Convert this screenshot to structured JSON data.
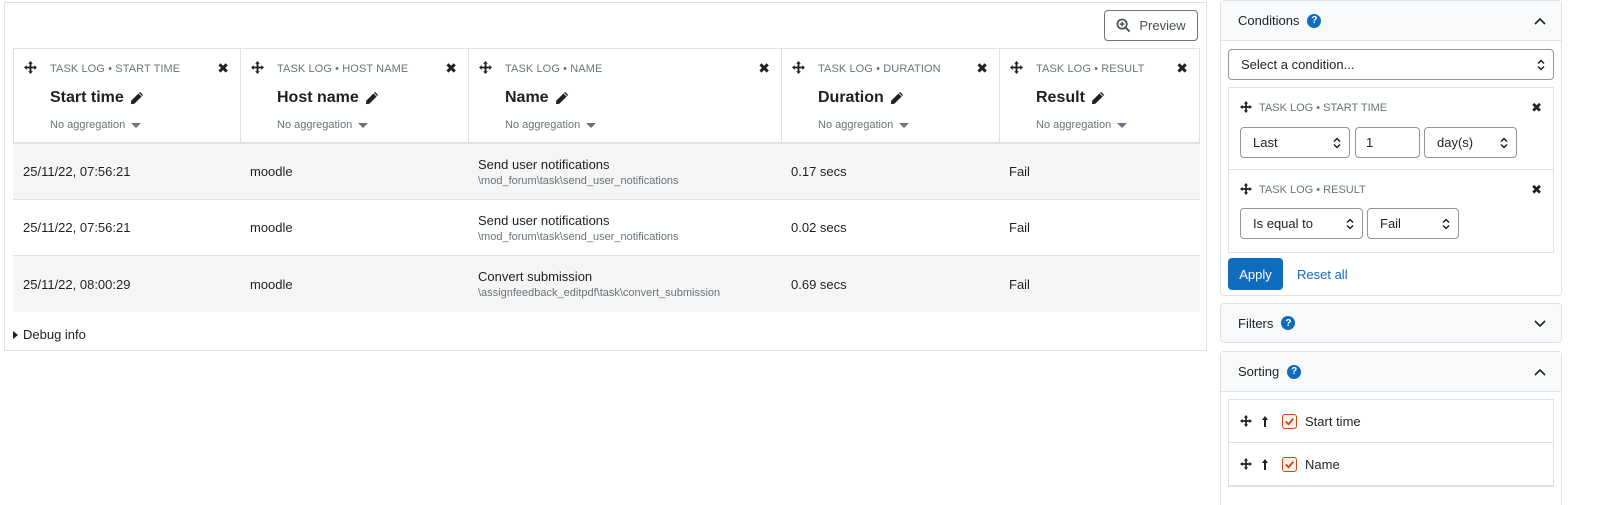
{
  "report": {
    "preview_label": "Preview",
    "debug_label": "Debug info",
    "columns": [
      {
        "crumb": "TASK LOG • START TIME",
        "title": "Start time",
        "aggregation": "No aggregation"
      },
      {
        "crumb": "TASK LOG • HOST NAME",
        "title": "Host name",
        "aggregation": "No aggregation"
      },
      {
        "crumb": "TASK LOG • NAME",
        "title": "Name",
        "aggregation": "No aggregation"
      },
      {
        "crumb": "TASK LOG • DURATION",
        "title": "Duration",
        "aggregation": "No aggregation"
      },
      {
        "crumb": "TASK LOG • RESULT",
        "title": "Result",
        "aggregation": "No aggregation"
      }
    ],
    "rows": [
      {
        "start": "25/11/22, 07:56:21",
        "host": "moodle",
        "name": "Send user notifications",
        "classname": "\\mod_forum\\task\\send_user_notifications",
        "duration": "0.17 secs",
        "result": "Fail"
      },
      {
        "start": "25/11/22, 07:56:21",
        "host": "moodle",
        "name": "Send user notifications",
        "classname": "\\mod_forum\\task\\send_user_notifications",
        "duration": "0.02 secs",
        "result": "Fail"
      },
      {
        "start": "25/11/22, 08:00:29",
        "host": "moodle",
        "name": "Convert submission",
        "classname": "\\assignfeedback_editpdf\\task\\convert_submission",
        "duration": "0.69 secs",
        "result": "Fail"
      }
    ]
  },
  "sidebar": {
    "conditions": {
      "title": "Conditions",
      "help": "?",
      "select_placeholder": "Select a condition...",
      "items": [
        {
          "crumb": "TASK LOG • START TIME",
          "operator": "Last",
          "value": "1",
          "unit": "day(s)"
        },
        {
          "crumb": "TASK LOG • RESULT",
          "operator": "Is equal to",
          "value": "Fail"
        }
      ],
      "apply_label": "Apply",
      "reset_label": "Reset all"
    },
    "filters": {
      "title": "Filters",
      "help": "?"
    },
    "sorting": {
      "title": "Sorting",
      "help": "?",
      "items": [
        {
          "label": "Start time"
        },
        {
          "label": "Name"
        }
      ]
    }
  },
  "colors": {
    "primary": "#0f6cbf",
    "checkbox": "#c24b12",
    "border": "#dee2e6"
  }
}
